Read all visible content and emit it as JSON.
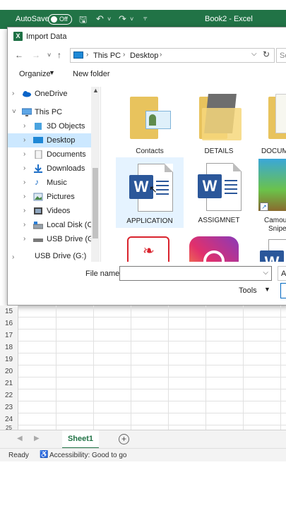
{
  "excel": {
    "autosave_label": "AutoSave",
    "autosave_state": "Off",
    "doc_title": "Book2  -  Excel",
    "save_icon": "save-icon",
    "undo_icon": "undo-icon",
    "redo_icon": "redo-icon",
    "accent_color": "#217346"
  },
  "dialog": {
    "title": "Import Data",
    "address": {
      "segments": [
        "This PC",
        "Desktop"
      ]
    },
    "search_placeholder": "Se",
    "organize_label": "Organize",
    "new_folder_label": "New folder",
    "nav_items": [
      {
        "label": "OneDrive",
        "icon": "cloud-icon"
      },
      {
        "label": "This PC",
        "icon": "computer-icon"
      },
      {
        "label": "3D Objects",
        "icon": "cube-icon"
      },
      {
        "label": "Desktop",
        "icon": "desktop-icon",
        "selected": true
      },
      {
        "label": "Documents",
        "icon": "document-icon"
      },
      {
        "label": "Downloads",
        "icon": "download-icon"
      },
      {
        "label": "Music",
        "icon": "music-icon"
      },
      {
        "label": "Pictures",
        "icon": "pictures-icon"
      },
      {
        "label": "Videos",
        "icon": "video-icon"
      },
      {
        "label": "Local Disk (C:)",
        "icon": "disk-icon"
      },
      {
        "label": "USB Drive (G:)",
        "icon": "usb-icon"
      },
      {
        "label": "USB Drive (G:)",
        "icon": "usb-icon"
      }
    ],
    "files": [
      {
        "name": "Contacts",
        "kind": "folder"
      },
      {
        "name": "DETAILS",
        "kind": "folder"
      },
      {
        "name": "DOCUM",
        "kind": "folder"
      },
      {
        "name": "APPLICATION",
        "kind": "word",
        "selected": true
      },
      {
        "name": "ASSIGMNET",
        "kind": "word"
      },
      {
        "name": "Camouf",
        "name2": "Sniper",
        "kind": "shortcut"
      },
      {
        "name": "",
        "kind": "pdf"
      },
      {
        "name": "",
        "kind": "instagram"
      },
      {
        "name": "",
        "kind": "word"
      }
    ],
    "file_name_label": "File name:",
    "file_name_value": "",
    "filter_label": "Al",
    "tools_label": "Tools"
  },
  "sheet": {
    "row_numbers": [
      "15",
      "16",
      "17",
      "18",
      "19",
      "20",
      "21",
      "22",
      "23",
      "24",
      "25"
    ],
    "tab_name": "Sheet1",
    "add_sheet_label": "+"
  },
  "status": {
    "ready": "Ready",
    "accessibility": "Accessibility: Good to go"
  }
}
